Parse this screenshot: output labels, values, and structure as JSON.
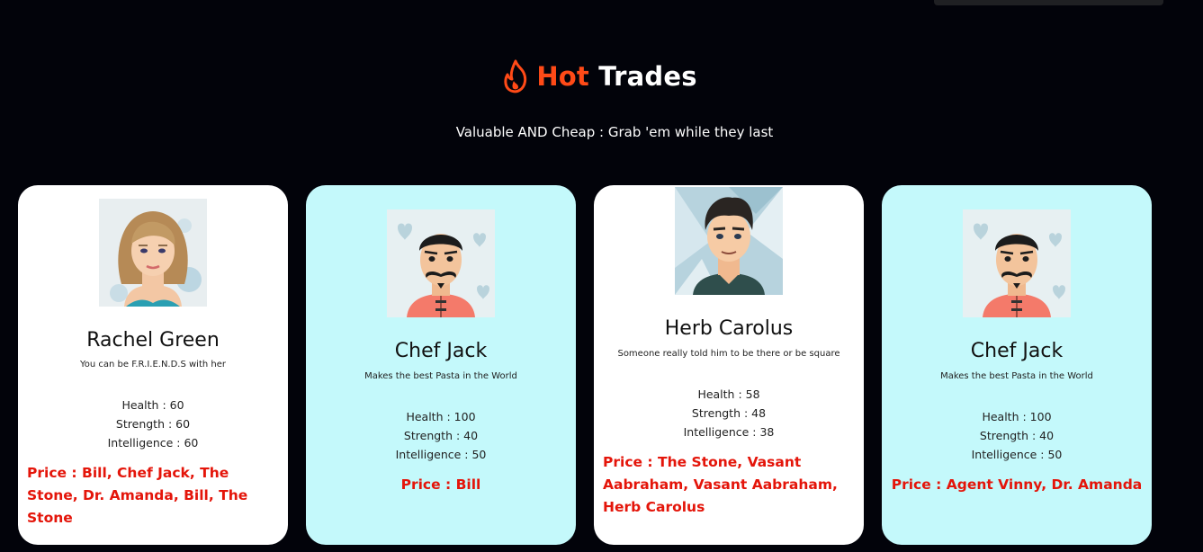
{
  "header": {
    "title_hot": "Hot",
    "title_trades": "Trades",
    "subtitle": "Valuable AND Cheap : Grab 'em while they last",
    "icon": "flame-icon"
  },
  "colors": {
    "background": "#02030a",
    "accent": "#ff4a17",
    "price": "#e4150a",
    "card_white": "#ffffff",
    "card_cyan": "#c4f9fb"
  },
  "cards": [
    {
      "name": "Rachel Green",
      "description": "You can be F.R.I.E.N.D.S with her",
      "health": "Health : 60",
      "strength": "Strength : 60",
      "intelligence": "Intelligence : 60",
      "price": "Price : Bill, Chef Jack, The Stone, Dr. Amanda, Bill, The Stone"
    },
    {
      "name": "Chef Jack",
      "description": "Makes the best Pasta in the World",
      "health": "Health : 100",
      "strength": "Strength : 40",
      "intelligence": "Intelligence : 50",
      "price": "Price : Bill"
    },
    {
      "name": "Herb Carolus",
      "description": "Someone really told him to be there or be square",
      "health": "Health : 58",
      "strength": "Strength : 48",
      "intelligence": "Intelligence : 38",
      "price": "Price : The Stone, Vasant Aabraham, Vasant Aabraham, Herb Carolus"
    },
    {
      "name": "Chef Jack",
      "description": "Makes the best Pasta in the World",
      "health": "Health : 100",
      "strength": "Strength : 40",
      "intelligence": "Intelligence : 50",
      "price": "Price : Agent Vinny, Dr. Amanda"
    }
  ]
}
